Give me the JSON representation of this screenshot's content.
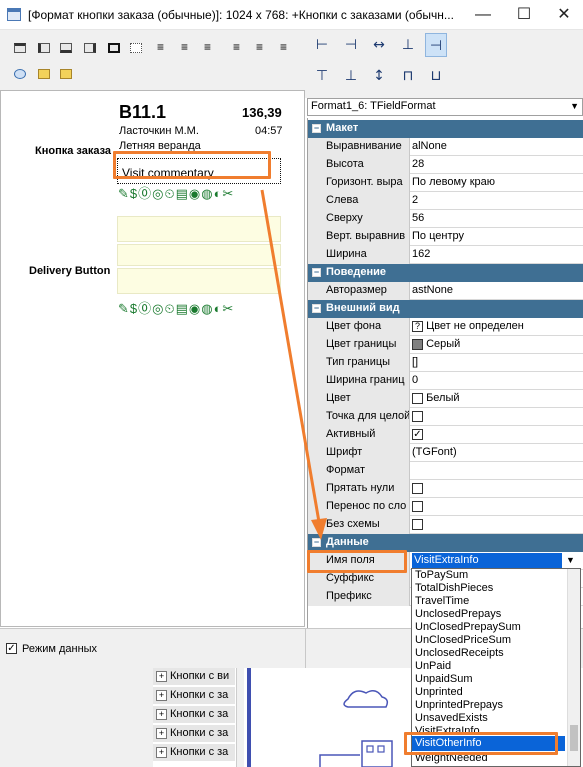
{
  "window": {
    "title": "[Формат кнопки заказа (обычные)]: 1024 x 768: +Кнопки с заказами (обычн...",
    "minimize": "—",
    "maximize": "☐",
    "close": "✕"
  },
  "canvas": {
    "row1_label": "Кнопка заказа",
    "row2_label": "Delivery Button",
    "order": {
      "number": "B11.1",
      "sum": "136,39",
      "waiter": "Ласточкин М.М.",
      "time": "04:57",
      "hall": "Летняя веранда",
      "comment": "Visit commentary"
    }
  },
  "property_grid": {
    "combo": "Format1_6: TFieldFormat",
    "groups": [
      {
        "name": "Макет",
        "rows": [
          {
            "name": "Выравнивание",
            "value": "alNone"
          },
          {
            "name": "Высота",
            "value": "28"
          },
          {
            "name": "Горизонт. выра",
            "value": "По левому краю"
          },
          {
            "name": "Слева",
            "value": "2"
          },
          {
            "name": "Сверху",
            "value": "56"
          },
          {
            "name": "Верт. выравнив",
            "value": "По центру"
          },
          {
            "name": "Ширина",
            "value": "162"
          }
        ]
      },
      {
        "name": "Поведение",
        "rows": [
          {
            "name": "Авторазмер",
            "value": "astNone"
          }
        ]
      },
      {
        "name": "Внешний вид",
        "rows": [
          {
            "name": "Цвет фона",
            "value": "Цвет не определен"
          },
          {
            "name": "Цвет границы",
            "value": "Серый"
          },
          {
            "name": "Тип границы",
            "value": "[]"
          },
          {
            "name": "Ширина границ",
            "value": "0"
          },
          {
            "name": "Цвет",
            "value": "Белый"
          },
          {
            "name": "Точка для целой",
            "value": ""
          },
          {
            "name": "Активный",
            "value": ""
          },
          {
            "name": "Шрифт",
            "value": "(TGFont)"
          },
          {
            "name": "Формат",
            "value": ""
          },
          {
            "name": "Прятать нули",
            "value": ""
          },
          {
            "name": "Перенос по сло",
            "value": ""
          },
          {
            "name": "Без схемы",
            "value": ""
          }
        ]
      },
      {
        "name": "Данные",
        "rows": [
          {
            "name": "Имя поля",
            "value": "VisitExtraInfo"
          },
          {
            "name": "Суффикс",
            "value": ""
          },
          {
            "name": "Префикс",
            "value": ""
          }
        ]
      }
    ],
    "colors": {
      "bg_unset": "#ffffff",
      "border": "#808080",
      "white": "#ffffff"
    }
  },
  "dropdown": {
    "items": [
      "ToPaySum",
      "TotalDishPieces",
      "TravelTime",
      "UnclosedPrepays",
      "UnClosedPrepaySum",
      "UnClosedPriceSum",
      "UnclosedReceipts",
      "UnPaid",
      "UnpaidSum",
      "Unprinted",
      "UnprintedPrepays",
      "UnsavedExists",
      "VisitExtraInfo",
      "VisitOtherInfo",
      "WeightNeeded"
    ],
    "selected": "VisitOtherInfo"
  },
  "bottom": {
    "data_mode": "Режим данных"
  },
  "tree_items": [
    "Кнопки с за",
    "Кнопки с за",
    "Кнопки с за",
    "Кнопки с за",
    "Кнопки с за",
    "Кнопки с за"
  ],
  "tree_first": "Кнопки с ви",
  "highlight_color": "#f07d2e"
}
